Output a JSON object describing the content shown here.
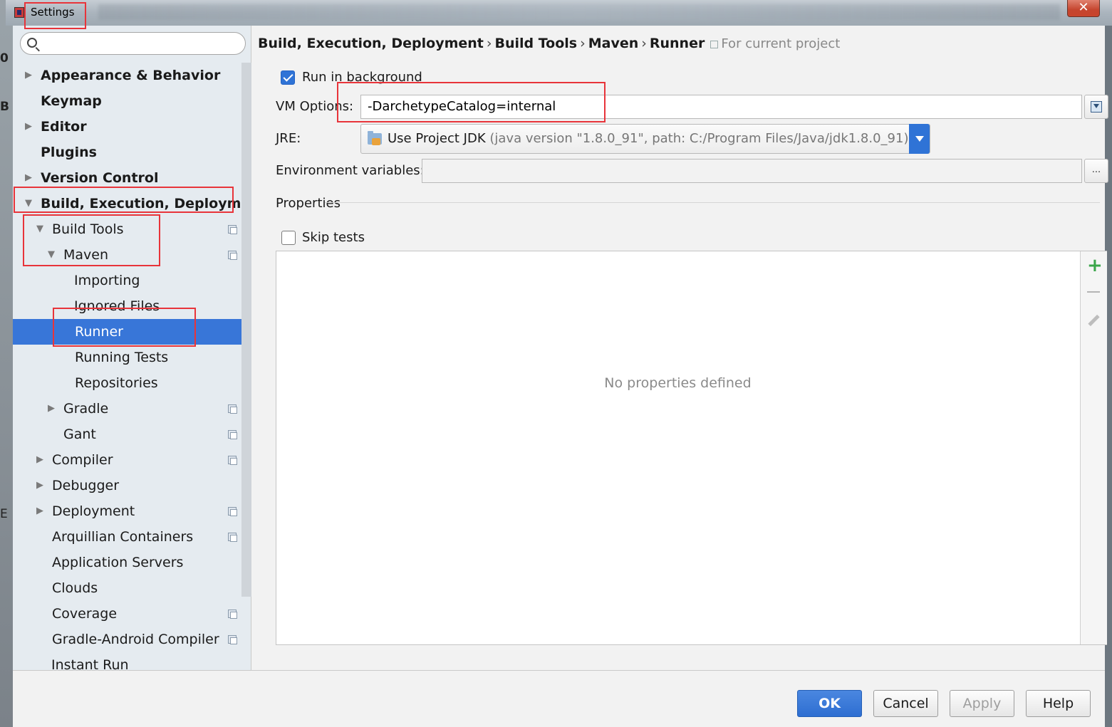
{
  "window": {
    "title": "Settings",
    "close_label": "✕"
  },
  "background": {
    "fragments": [
      "0",
      "B",
      "E"
    ]
  },
  "sidebar": {
    "search_placeholder": "",
    "items": [
      {
        "label": "Appearance & Behavior",
        "arrow": "▶"
      },
      {
        "label": "Keymap"
      },
      {
        "label": "Editor",
        "arrow": "▶"
      },
      {
        "label": "Plugins"
      },
      {
        "label": "Version Control",
        "arrow": "▶"
      },
      {
        "label": "Build, Execution, Deployment",
        "arrow": "▼"
      },
      {
        "label": "Build Tools",
        "arrow": "▼"
      },
      {
        "label": "Maven",
        "arrow": "▼"
      },
      {
        "label": "Importing"
      },
      {
        "label": "Ignored Files"
      },
      {
        "label": "Runner"
      },
      {
        "label": "Running Tests"
      },
      {
        "label": "Repositories"
      },
      {
        "label": "Gradle",
        "arrow": "▶"
      },
      {
        "label": "Gant"
      },
      {
        "label": "Compiler",
        "arrow": "▶"
      },
      {
        "label": "Debugger",
        "arrow": "▶"
      },
      {
        "label": "Deployment",
        "arrow": "▶"
      },
      {
        "label": "Arquillian Containers"
      },
      {
        "label": "Application Servers"
      },
      {
        "label": "Clouds"
      },
      {
        "label": "Coverage"
      },
      {
        "label": "Gradle-Android Compiler"
      },
      {
        "label": "Instant Run"
      }
    ]
  },
  "breadcrumb": {
    "parts": [
      "Build, Execution, Deployment",
      "Build Tools",
      "Maven",
      "Runner"
    ],
    "separator": "›",
    "scope": "For current project"
  },
  "form": {
    "run_in_background_label": "Run in background",
    "run_in_background_checked": true,
    "vm_options_label": "VM Options:",
    "vm_options_value": "-DarchetypeCatalog=internal",
    "jre_label": "JRE:",
    "jre_main": "Use Project JDK",
    "jre_detail": "(java version \"1.8.0_91\", path: C:/Program Files/Java/jdk1.8.0_91)",
    "env_vars_label": "Environment variables:",
    "env_vars_value": "",
    "env_vars_button": "...",
    "properties_label": "Properties",
    "skip_tests_label": "Skip tests",
    "skip_tests_checked": false,
    "properties_empty": "No properties defined"
  },
  "buttons": {
    "ok": "OK",
    "cancel": "Cancel",
    "apply": "Apply",
    "help": "Help"
  },
  "colors": {
    "accent": "#3876d8",
    "highlight_box": "#e8343a",
    "add_green": "#3aa64a"
  }
}
